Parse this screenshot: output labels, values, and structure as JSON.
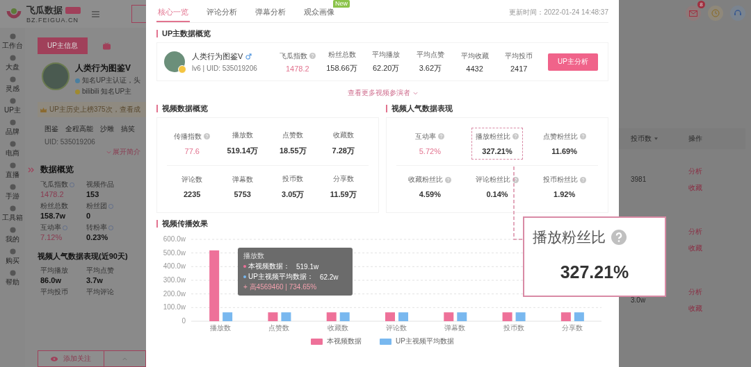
{
  "app": {
    "logo_text": "飞瓜数据",
    "domain": "BZ.FEIGUA.CN"
  },
  "sidebar": [
    {
      "label": "工作台"
    },
    {
      "label": "大盘"
    },
    {
      "label": "灵感"
    },
    {
      "label": "UP主"
    },
    {
      "label": "品牌"
    },
    {
      "label": "电商"
    },
    {
      "label": "直播"
    },
    {
      "label": "手游"
    },
    {
      "label": "工具箱"
    },
    {
      "label": "我的"
    },
    {
      "label": "购买"
    },
    {
      "label": "帮助"
    }
  ],
  "profile_panel": {
    "tab": "UP主信息",
    "name": "人类行为图鉴V",
    "badges": [
      "知名UP主认证，头",
      "bilibili 知名UP主"
    ],
    "banner": "UP主历史上榜375次，查看成",
    "tags": [
      "图鉴",
      "全程高能",
      "沙雕",
      "搞笑"
    ],
    "uid": "UID: 535019206",
    "expand_link": "展开简介",
    "overview_title": "数据概览",
    "overview_stats": [
      {
        "label": "飞瓜指数",
        "value": "1478.2",
        "highlight": true,
        "help": true
      },
      {
        "label": "视频作品",
        "value": "153",
        "highlight": false,
        "help": false
      },
      {
        "label": "粉丝总数",
        "value": "158.7w",
        "highlight": false,
        "help": false
      },
      {
        "label": "粉丝团",
        "value": "0",
        "highlight": false,
        "help": true
      },
      {
        "label": "互动率",
        "value": "7.12%",
        "highlight": true,
        "help": true
      },
      {
        "label": "转粉率",
        "value": "0.23%",
        "highlight": false,
        "help": true
      }
    ],
    "popularity_title": "视频人气数据表现(近90天)",
    "popularity_stats": [
      {
        "label": "平均播放",
        "value": "86.0w"
      },
      {
        "label": "平均点赞",
        "value": "3.7w"
      },
      {
        "label": "平均投币"
      },
      {
        "label": "平均评论"
      }
    ],
    "follow_button": "添加关注"
  },
  "header_icons": {
    "mail_badge": "8"
  },
  "right_table": {
    "columns": [
      "投币数",
      "操作"
    ],
    "rows": [
      {
        "coins": "3981",
        "actions": [
          "分析",
          "收藏"
        ]
      },
      {
        "actions": [
          "分析",
          "收藏"
        ]
      },
      {
        "coins": "3.0w",
        "actions": [
          "分析",
          "收藏"
        ]
      }
    ]
  },
  "modal": {
    "tabs": [
      {
        "label": "核心一览",
        "selected": true
      },
      {
        "label": "评论分析",
        "selected": false
      },
      {
        "label": "弹幕分析",
        "selected": false
      },
      {
        "label": "观众画像",
        "selected": false,
        "badge": "New"
      }
    ],
    "updated": "更新时间：2022-01-24 14:48:37",
    "up_overview": {
      "title": "UP主数据概览",
      "name": "人类行为图鉴V",
      "meta": "lv6 | UID: 535019206",
      "stats": [
        {
          "label": "飞瓜指数",
          "value": "1478.2",
          "highlight": true,
          "help": true
        },
        {
          "label": "粉丝总数",
          "value": "158.66万",
          "highlight": false,
          "help": false
        },
        {
          "label": "平均播放",
          "value": "62.20万",
          "highlight": false,
          "help": false
        },
        {
          "label": "平均点赞",
          "value": "3.62万",
          "highlight": false,
          "help": false
        },
        {
          "label": "平均收藏",
          "value": "4432",
          "highlight": false,
          "help": false
        },
        {
          "label": "平均投币",
          "value": "2417",
          "highlight": false,
          "help": false
        }
      ],
      "button": "UP主分析",
      "more_link": "查看更多视频参演者"
    },
    "video_overview": {
      "title": "视频数据概览",
      "stats": [
        {
          "label": "传播指数",
          "value": "77.6",
          "highlight": true,
          "help": true
        },
        {
          "label": "播放数",
          "value": "519.14万",
          "highlight": false,
          "help": false
        },
        {
          "label": "点赞数",
          "value": "18.55万",
          "highlight": false,
          "help": false
        },
        {
          "label": "收藏数",
          "value": "7.28万",
          "highlight": false,
          "help": false
        },
        {
          "label": "评论数",
          "value": "2235",
          "highlight": false,
          "help": false
        },
        {
          "label": "弹幕数",
          "value": "5753",
          "highlight": false,
          "help": false
        },
        {
          "label": "投币数",
          "value": "3.05万",
          "highlight": false,
          "help": false
        },
        {
          "label": "分享数",
          "value": "11.59万",
          "highlight": false,
          "help": false
        }
      ]
    },
    "popularity": {
      "title": "视频人气数据表现",
      "stats": [
        {
          "label": "互动率",
          "value": "5.72%",
          "highlight": true,
          "help": true,
          "focused": false
        },
        {
          "label": "播放粉丝比",
          "value": "327.21%",
          "highlight": false,
          "help": true,
          "focused": true
        },
        {
          "label": "点赞粉丝比",
          "value": "11.69%",
          "highlight": false,
          "help": true,
          "focused": false
        },
        {
          "label": "收藏粉丝比",
          "value": "4.59%",
          "highlight": false,
          "help": true,
          "focused": false
        },
        {
          "label": "评论粉丝比",
          "value": "0.14%",
          "highlight": false,
          "help": true,
          "focused": false
        },
        {
          "label": "投币粉丝比",
          "value": "1.92%",
          "highlight": false,
          "help": true,
          "focused": false
        }
      ]
    },
    "spread": {
      "title": "视频传播效果",
      "chart_data": {
        "type": "bar",
        "grid": true,
        "legend": true,
        "categories": [
          "播放数",
          "点赞数",
          "收藏数",
          "评论数",
          "弹幕数",
          "投币数",
          "分享数"
        ],
        "series": [
          {
            "name": "本视频数据",
            "color": "#ee7199",
            "values": [
              519.1,
              65,
              65,
              65,
              65,
              65,
              65
            ]
          },
          {
            "name": "UP主视频平均数据",
            "color": "#79b8ef",
            "values": [
              65,
              65,
              65,
              65,
              65,
              65,
              65
            ]
          }
        ],
        "ylim": [
          0,
          600
        ],
        "yticks": [
          {
            "value": 0,
            "label": "0"
          },
          {
            "value": 100,
            "label": "100.0w"
          },
          {
            "value": 200,
            "label": "200.0w"
          },
          {
            "value": 300,
            "label": "300.0w"
          },
          {
            "value": 400,
            "label": "400.0w"
          },
          {
            "value": 500,
            "label": "500.0w"
          },
          {
            "value": 600,
            "label": "600.0w"
          }
        ]
      },
      "tooltip": {
        "title": "播放数",
        "lines": [
          {
            "label": "本视频数据：",
            "value": "519.1w",
            "color": "#ee7199"
          },
          {
            "label": "UP主视频平均数据：",
            "value": "62.2w",
            "color": "#79b8ef"
          }
        ],
        "diff": "+ 高4569460 | 734.65%"
      }
    }
  },
  "callout": {
    "label": "播放粉丝比",
    "value": "327.21%"
  }
}
